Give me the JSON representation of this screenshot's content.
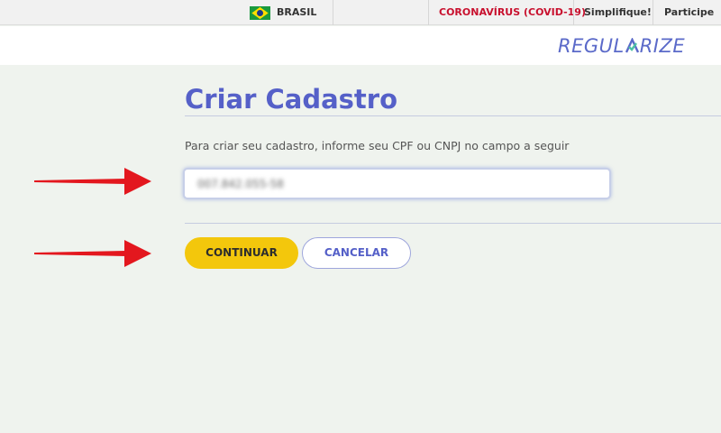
{
  "govbar": {
    "country": "BRASIL",
    "links": {
      "covid": "CORONAVÍRUS (COVID-19)",
      "simplifique": "Simplifique!",
      "participe": "Participe"
    }
  },
  "header": {
    "logo_left": "REGUL",
    "logo_right": "RIZE"
  },
  "main": {
    "title": "Criar Cadastro",
    "instruction": "Para criar seu cadastro, informe seu CPF ou CNPJ no campo a seguir",
    "document_field": {
      "value": "007.842.055-58"
    },
    "buttons": {
      "continue": "CONTINUAR",
      "cancel": "CANCELAR"
    }
  },
  "colors": {
    "accent": "#5560c8",
    "continue_button": "#f3c70c",
    "arrow": "#e3171e",
    "covid_link": "#c8102e",
    "background": "#eff3ee"
  },
  "icons": {
    "flag": "brazil-flag-icon",
    "annotation": "red-arrow-icon"
  }
}
